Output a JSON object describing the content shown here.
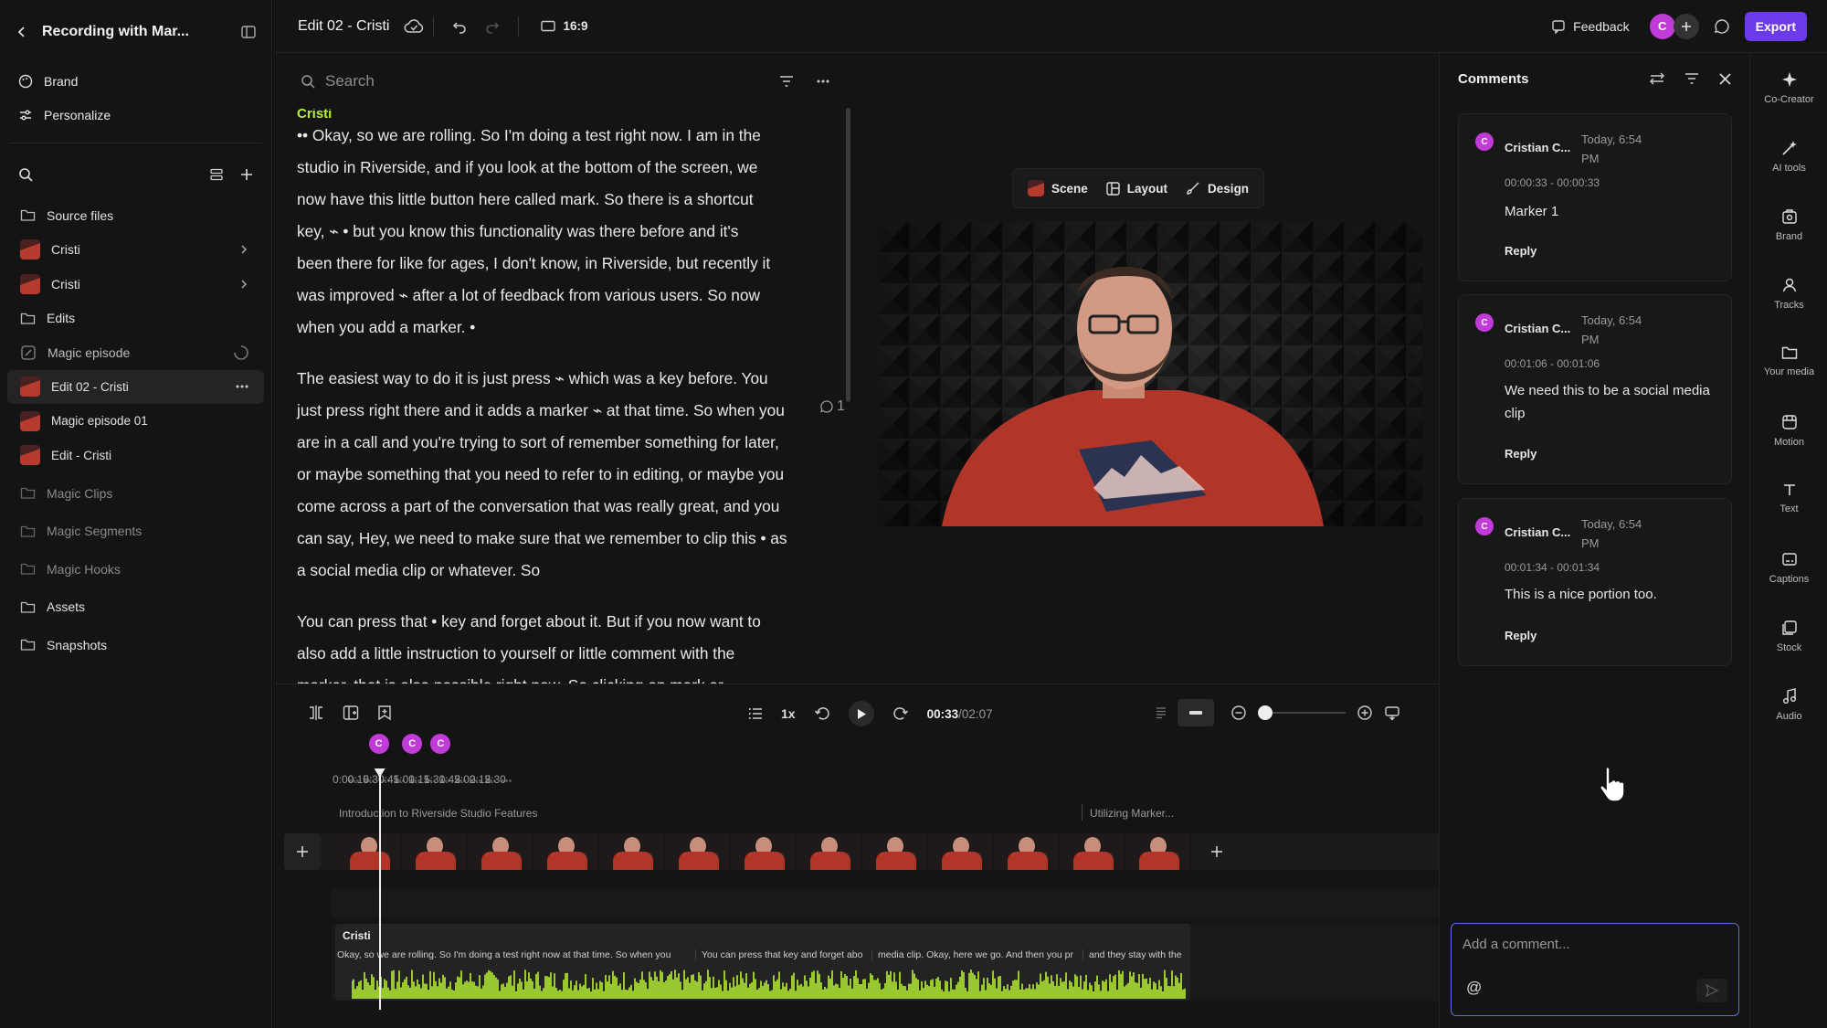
{
  "sidebar": {
    "project_title": "Recording with Mar...",
    "brand": "Brand",
    "personalize": "Personalize",
    "items": [
      {
        "label": "Source files",
        "kind": "folder"
      },
      {
        "label": "Cristi",
        "kind": "recording"
      },
      {
        "label": "Cristi",
        "kind": "recording"
      },
      {
        "label": "Edits",
        "kind": "folder"
      },
      {
        "label": "Magic episode",
        "kind": "magic"
      },
      {
        "label": "Edit 02 - Cristi",
        "kind": "edit"
      },
      {
        "label": "Magic episode 01",
        "kind": "edit"
      },
      {
        "label": "Edit - Cristi",
        "kind": "edit"
      },
      {
        "label": "Magic Clips",
        "kind": "folder"
      },
      {
        "label": "Magic Segments",
        "kind": "folder"
      },
      {
        "label": "Magic Hooks",
        "kind": "folder"
      },
      {
        "label": "Assets",
        "kind": "folder"
      },
      {
        "label": "Snapshots",
        "kind": "folder"
      }
    ]
  },
  "topbar": {
    "edit_title": "Edit 02 - Cristi",
    "aspect": "16:9",
    "feedback": "Feedback",
    "avatar_initial": "C",
    "export": "Export"
  },
  "transcript": {
    "search_placeholder": "Search",
    "speaker": "Cristi",
    "paragraphs": [
      {
        "lines": [
          "•• Okay, so we are rolling. So I'm doing a test right now. I am in the",
          "studio in Riverside, and if you look at the bottom of the screen, we",
          "now have this little button here called mark. So there is a shortcut",
          "key, ⌁ • but you know this functionality was there before and it's",
          "been there for like for ages, I don't know, in Riverside, but recently it",
          "was improved ⌁ after a lot of feedback from various users. So now",
          "when you add a marker. •"
        ]
      },
      {
        "lines": [
          "The easiest way to do it is just press ⌁ which was a key before. You",
          "just press right there and it adds a marker ⌁ at that time. So when you",
          "are in a call and you're trying to sort of remember something for later,",
          "or maybe something that you need to refer to in editing, or maybe you",
          "come across a part of the conversation that was really great, and you",
          "can say, Hey, we need to make sure that we remember to clip this • as",
          "a social media clip or whatever. So"
        ]
      },
      {
        "lines": [
          "You can press that • key and forget about it. But if you now want to",
          "also add a little instruction to yourself or little comment with the",
          "marker, that is also possible right now. So clicking on mark or"
        ]
      }
    ],
    "comment_count": "1"
  },
  "preview": {
    "scene": "Scene",
    "layout": "Layout",
    "design": "Design"
  },
  "playback": {
    "speed": "1x",
    "current": "00:33",
    "total": "/02:07"
  },
  "timeline": {
    "ticks": [
      "0:00",
      "0:15",
      "0:30",
      "0:45",
      "1:00",
      "1:15",
      "1:30",
      "1:45",
      "2:00",
      "2:15",
      "2:30"
    ],
    "markers": [
      {
        "label": "C",
        "time_s": 33
      },
      {
        "label": "C",
        "time_s": 66
      },
      {
        "label": "C",
        "time_s": 94
      }
    ],
    "playhead_s": 33,
    "chapters": [
      "Introduction to Riverside Studio Features",
      "Utilizing Marker..."
    ],
    "audio_track": "Cristi",
    "captions": [
      "Okay, so we are rolling. So I'm doing a test right now at that time. So when you",
      "You can press that key and forget abo",
      "media clip. Okay, here we go. And then you pr",
      "and they stay with the"
    ]
  },
  "comments": {
    "title": "Comments",
    "items": [
      {
        "initial": "C",
        "author": "Cristian C...",
        "date": "Today, 6:54 PM",
        "timecode": "00:00:33 - 00:00:33",
        "text": "Marker 1",
        "reply": "Reply"
      },
      {
        "initial": "C",
        "author": "Cristian C...",
        "date": "Today, 6:54 PM",
        "timecode": "00:01:06 - 00:01:06",
        "text": "We need this to be a social media clip",
        "reply": "Reply"
      },
      {
        "initial": "C",
        "author": "Cristian C...",
        "date": "Today, 6:54 PM",
        "timecode": "00:01:34 - 00:01:34",
        "text": "This is a nice portion too.",
        "reply": "Reply"
      }
    ],
    "input_placeholder": "Add a comment...",
    "mention": "@"
  },
  "rail": [
    "Co-Creator",
    "AI tools",
    "Brand",
    "Tracks",
    "Your media",
    "Motion",
    "Text",
    "Captions",
    "Stock",
    "Audio"
  ],
  "colors": {
    "accent": "#6d3ae8",
    "marker": "#c13bd8",
    "speaker": "#b7f135",
    "waveform": "#b7f135"
  }
}
